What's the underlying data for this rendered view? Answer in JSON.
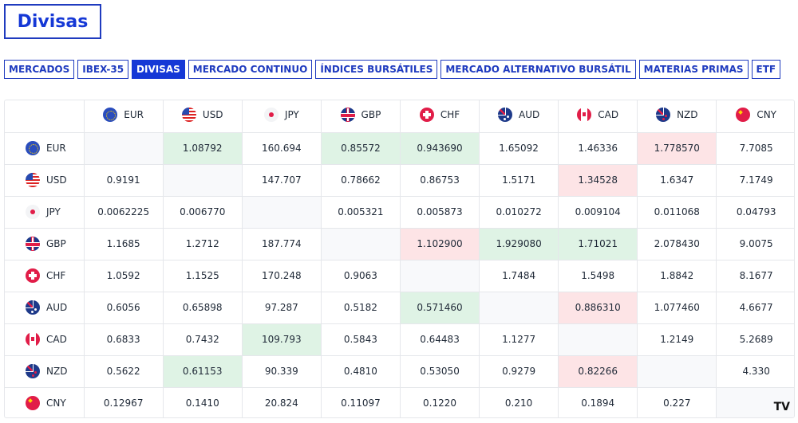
{
  "title": "Divisas",
  "tabs": [
    {
      "label": "MERCADOS",
      "active": false
    },
    {
      "label": "IBEX-35",
      "active": false
    },
    {
      "label": "DIVISAS",
      "active": true
    },
    {
      "label": "MERCADO CONTINUO",
      "active": false
    },
    {
      "label": "ÍNDICES BURSÁTILES",
      "active": false
    },
    {
      "label": "MERCADO ALTERNATIVO BURSÁTIL",
      "active": false
    },
    {
      "label": "MATERIAS PRIMAS",
      "active": false
    },
    {
      "label": "ETF",
      "active": false
    }
  ],
  "colors": {
    "accent": "#1538d6",
    "positive": "#dff3e5",
    "negative": "#fde4e6"
  },
  "currencies": [
    {
      "code": "EUR",
      "flag": "eu-flag-icon"
    },
    {
      "code": "USD",
      "flag": "us-flag-icon"
    },
    {
      "code": "JPY",
      "flag": "jp-flag-icon"
    },
    {
      "code": "GBP",
      "flag": "gb-flag-icon"
    },
    {
      "code": "CHF",
      "flag": "ch-flag-icon"
    },
    {
      "code": "AUD",
      "flag": "au-flag-icon"
    },
    {
      "code": "CAD",
      "flag": "ca-flag-icon"
    },
    {
      "code": "NZD",
      "flag": "nz-flag-icon"
    },
    {
      "code": "CNY",
      "flag": "cn-flag-icon"
    }
  ],
  "rows": [
    [
      {
        "v": "",
        "s": "empty"
      },
      {
        "v": "1.08792",
        "s": "up"
      },
      {
        "v": "160.694",
        "s": ""
      },
      {
        "v": "0.85572",
        "s": "up"
      },
      {
        "v": "0.943690",
        "s": "up"
      },
      {
        "v": "1.65092",
        "s": ""
      },
      {
        "v": "1.46336",
        "s": ""
      },
      {
        "v": "1.778570",
        "s": "down"
      },
      {
        "v": "7.7085",
        "s": ""
      }
    ],
    [
      {
        "v": "0.9191",
        "s": ""
      },
      {
        "v": "",
        "s": "empty"
      },
      {
        "v": "147.707",
        "s": ""
      },
      {
        "v": "0.78662",
        "s": ""
      },
      {
        "v": "0.86753",
        "s": ""
      },
      {
        "v": "1.5171",
        "s": ""
      },
      {
        "v": "1.34528",
        "s": "down"
      },
      {
        "v": "1.6347",
        "s": ""
      },
      {
        "v": "7.1749",
        "s": ""
      }
    ],
    [
      {
        "v": "0.0062225",
        "s": ""
      },
      {
        "v": "0.006770",
        "s": ""
      },
      {
        "v": "",
        "s": "empty"
      },
      {
        "v": "0.005321",
        "s": ""
      },
      {
        "v": "0.005873",
        "s": ""
      },
      {
        "v": "0.010272",
        "s": ""
      },
      {
        "v": "0.009104",
        "s": ""
      },
      {
        "v": "0.011068",
        "s": ""
      },
      {
        "v": "0.04793",
        "s": ""
      }
    ],
    [
      {
        "v": "1.1685",
        "s": ""
      },
      {
        "v": "1.2712",
        "s": ""
      },
      {
        "v": "187.774",
        "s": ""
      },
      {
        "v": "",
        "s": "empty"
      },
      {
        "v": "1.102900",
        "s": "down"
      },
      {
        "v": "1.929080",
        "s": "up"
      },
      {
        "v": "1.71021",
        "s": "up"
      },
      {
        "v": "2.078430",
        "s": ""
      },
      {
        "v": "9.0075",
        "s": ""
      }
    ],
    [
      {
        "v": "1.0592",
        "s": ""
      },
      {
        "v": "1.1525",
        "s": ""
      },
      {
        "v": "170.248",
        "s": ""
      },
      {
        "v": "0.9063",
        "s": ""
      },
      {
        "v": "",
        "s": "empty"
      },
      {
        "v": "1.7484",
        "s": ""
      },
      {
        "v": "1.5498",
        "s": ""
      },
      {
        "v": "1.8842",
        "s": ""
      },
      {
        "v": "8.1677",
        "s": ""
      }
    ],
    [
      {
        "v": "0.6056",
        "s": ""
      },
      {
        "v": "0.65898",
        "s": ""
      },
      {
        "v": "97.287",
        "s": ""
      },
      {
        "v": "0.5182",
        "s": ""
      },
      {
        "v": "0.571460",
        "s": "up"
      },
      {
        "v": "",
        "s": "empty"
      },
      {
        "v": "0.886310",
        "s": "down"
      },
      {
        "v": "1.077460",
        "s": ""
      },
      {
        "v": "4.6677",
        "s": ""
      }
    ],
    [
      {
        "v": "0.6833",
        "s": ""
      },
      {
        "v": "0.7432",
        "s": ""
      },
      {
        "v": "109.793",
        "s": "up"
      },
      {
        "v": "0.5843",
        "s": ""
      },
      {
        "v": "0.64483",
        "s": ""
      },
      {
        "v": "1.1277",
        "s": ""
      },
      {
        "v": "",
        "s": "empty"
      },
      {
        "v": "1.2149",
        "s": ""
      },
      {
        "v": "5.2689",
        "s": ""
      }
    ],
    [
      {
        "v": "0.5622",
        "s": ""
      },
      {
        "v": "0.61153",
        "s": "up"
      },
      {
        "v": "90.339",
        "s": ""
      },
      {
        "v": "0.4810",
        "s": ""
      },
      {
        "v": "0.53050",
        "s": ""
      },
      {
        "v": "0.9279",
        "s": ""
      },
      {
        "v": "0.82266",
        "s": "down"
      },
      {
        "v": "",
        "s": "empty"
      },
      {
        "v": "4.330",
        "s": ""
      }
    ],
    [
      {
        "v": "0.12967",
        "s": ""
      },
      {
        "v": "0.1410",
        "s": ""
      },
      {
        "v": "20.824",
        "s": ""
      },
      {
        "v": "0.11097",
        "s": ""
      },
      {
        "v": "0.1220",
        "s": ""
      },
      {
        "v": "0.210",
        "s": ""
      },
      {
        "v": "0.1894",
        "s": ""
      },
      {
        "v": "0.227",
        "s": ""
      },
      {
        "v": "",
        "s": "empty"
      }
    ]
  ],
  "watermark": {
    "label": "TV",
    "icon": "tradingview-logo-icon"
  }
}
